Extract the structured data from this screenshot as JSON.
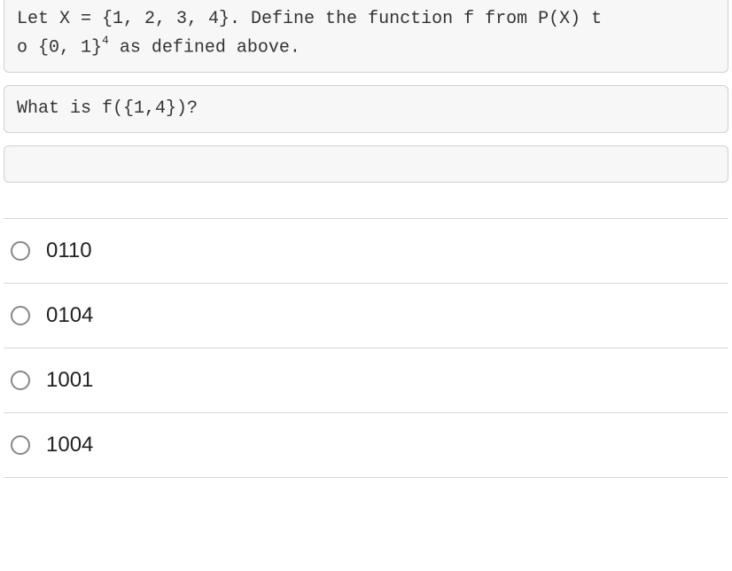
{
  "context": {
    "line1": "Let X = {1, 2, 3, 4}. Define the function f from P(X) t",
    "line2_pre": "o {0, 1}",
    "line2_sup": "4",
    "line2_post": " as defined above."
  },
  "question": "What is f({1,4})?",
  "options": [
    {
      "label": "0110"
    },
    {
      "label": "0104"
    },
    {
      "label": "1001"
    },
    {
      "label": "1004"
    }
  ]
}
